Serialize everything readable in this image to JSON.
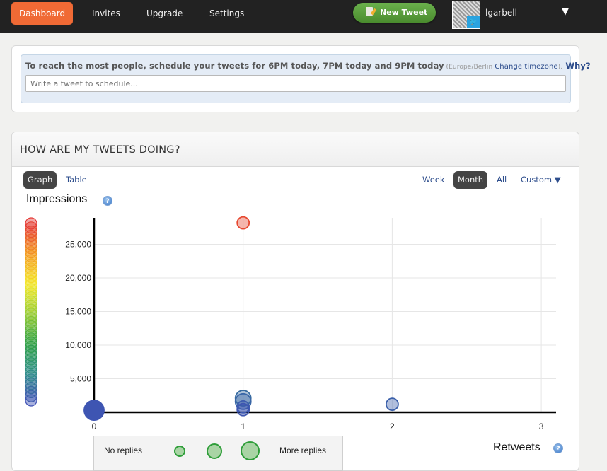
{
  "nav": {
    "items": [
      {
        "label": "Dashboard",
        "active": true
      },
      {
        "label": "Invites",
        "active": false
      },
      {
        "label": "Upgrade",
        "active": false
      },
      {
        "label": "Settings",
        "active": false
      }
    ],
    "new_tweet_label": "New Tweet",
    "new_tweet_icon": "compose-icon",
    "username": "lgarbell",
    "user_menu_icon": "caret-down-icon",
    "avatar_badge_icon": "twitter-bird-icon"
  },
  "schedule": {
    "message": "To reach the most people, schedule your tweets for 6PM today, 7PM today and 9PM today",
    "timezone_open": " (Europe/Berlin ",
    "change_timezone": "Change timezone",
    "timezone_close": ").",
    "why": " Why?",
    "input_placeholder": "Write a tweet to schedule...",
    "input_value": ""
  },
  "stats": {
    "title": "HOW ARE MY TWEETS DOING?",
    "view_tabs": [
      {
        "label": "Graph",
        "active": true
      },
      {
        "label": "Table",
        "active": false
      }
    ],
    "range_tabs": [
      {
        "label": "Week",
        "active": false
      },
      {
        "label": "Month",
        "active": true
      },
      {
        "label": "All",
        "active": false
      },
      {
        "label": "Custom ▼",
        "active": false
      }
    ],
    "impressions_label": "Impressions",
    "retweets_label": "Retweets",
    "help_icon_glyph": "?",
    "size_legend": {
      "left_label": "No replies",
      "right_label": "More replies",
      "colors": {
        "fill": "#a9d4a5",
        "stroke": "#2f9e3a"
      }
    }
  },
  "chart_data": {
    "type": "scatter",
    "title": "",
    "xlabel": "Retweets",
    "ylabel": "Impressions",
    "x_ticks": [
      0,
      1,
      2,
      3
    ],
    "y_ticks": [
      5000,
      10000,
      15000,
      20000,
      25000
    ],
    "y_tick_labels": [
      "5,000",
      "10,000",
      "15,000",
      "20,000",
      "25,000"
    ],
    "xlim": [
      0,
      3.1
    ],
    "ylim": [
      0,
      29000
    ],
    "grid": true,
    "color_scale": {
      "low": "#3f51b5",
      "high": "#e53935",
      "stops": [
        "#3f51b5",
        "#2e8f88",
        "#2ea043",
        "#9acd32",
        "#f5e92a",
        "#f39c1e",
        "#e53935"
      ],
      "encodes": "impressions",
      "placement": "left"
    },
    "size_encodes": "replies",
    "points": [
      {
        "x": 0,
        "y": 300,
        "size": 3
      },
      {
        "x": 1,
        "y": 28200,
        "size": 1
      },
      {
        "x": 1,
        "y": 2100,
        "size": 2
      },
      {
        "x": 1,
        "y": 1600,
        "size": 2
      },
      {
        "x": 1,
        "y": 800,
        "size": 1
      },
      {
        "x": 1,
        "y": 400,
        "size": 1
      },
      {
        "x": 2,
        "y": 1200,
        "size": 1
      }
    ]
  }
}
